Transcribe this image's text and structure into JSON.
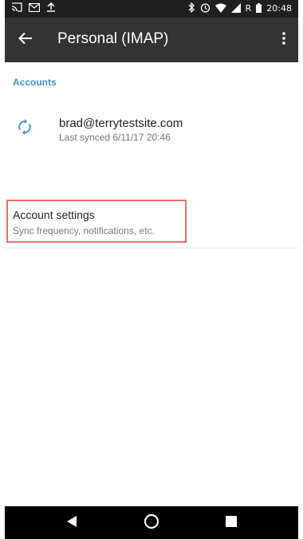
{
  "status_bar": {
    "time": "20:48",
    "icons_left": [
      "cast-icon",
      "gmail-icon",
      "upload-icon"
    ],
    "icons_right": [
      "bluetooth-icon",
      "alarm-icon",
      "wifi-icon",
      "signal-icon",
      "battery-icon"
    ],
    "roaming": "R"
  },
  "app_bar": {
    "title": "Personal (IMAP)",
    "back_icon": "arrow-back-icon",
    "menu_icon": "more-vert-icon"
  },
  "accounts": {
    "section_label": "Accounts",
    "items": [
      {
        "email": "brad@terrytestsite.com",
        "subtitle": "Last synced 6/11/17 20:46",
        "icon": "sync-icon"
      }
    ]
  },
  "settings": {
    "title": "Account settings",
    "subtitle": "Sync frequency, notifications, etc."
  },
  "nav_bar": {
    "buttons": [
      "back-triangle-icon",
      "home-circle-icon",
      "recents-square-icon"
    ]
  },
  "colors": {
    "app_bar": "#333333",
    "status_bar": "#1f1f1f",
    "accent": "#4a8fd6",
    "highlight": "#e0726a"
  }
}
